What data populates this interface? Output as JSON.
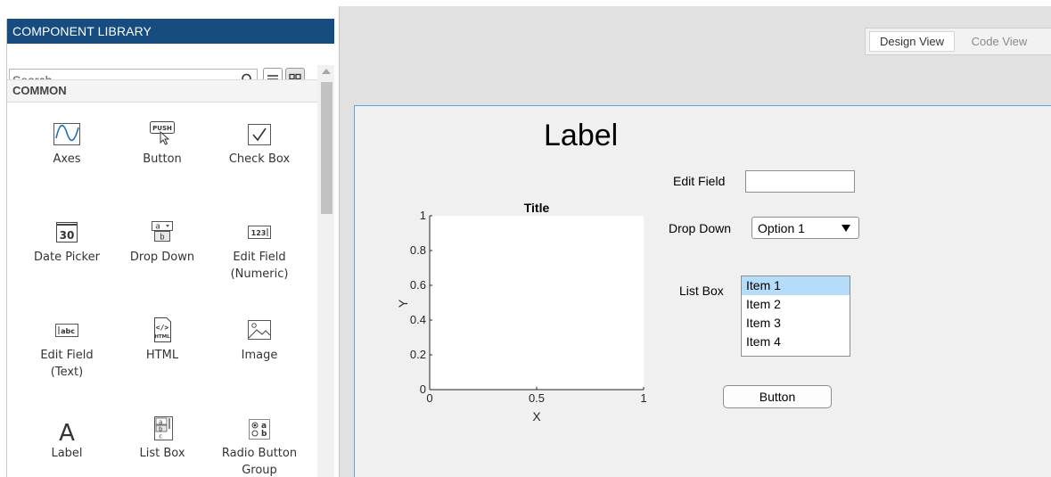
{
  "library": {
    "header": "COMPONENT LIBRARY",
    "search_placeholder": "Search",
    "category": "COMMON",
    "components": [
      {
        "label": "Axes",
        "icon": "axes-icon"
      },
      {
        "label": "Button",
        "icon": "push-button-icon",
        "icon_text": "PUSH"
      },
      {
        "label": "Check Box",
        "icon": "checkbox-icon"
      },
      {
        "label": "Date Picker",
        "icon": "calendar-icon",
        "icon_text": "30"
      },
      {
        "label": "Drop Down",
        "icon": "dropdown-icon",
        "icon_text_a": "a",
        "icon_text_b": "b"
      },
      {
        "label": "Edit Field\n(Numeric)",
        "label_line1": "Edit Field",
        "label_line2": "(Numeric)",
        "icon": "numeric-field-icon",
        "icon_text": "123"
      },
      {
        "label_line1": "Edit Field",
        "label_line2": "(Text)",
        "icon": "text-field-icon",
        "icon_text": "abc"
      },
      {
        "label": "HTML",
        "icon": "html-icon",
        "icon_text_a": "</>",
        "icon_text_b": "HTML"
      },
      {
        "label": "Image",
        "icon": "image-icon"
      },
      {
        "label": "Label",
        "icon": "label-icon",
        "icon_text": "A"
      },
      {
        "label": "List Box",
        "icon": "listbox-icon",
        "icon_text_a": "a",
        "icon_text_b": "b",
        "icon_text_c": "c"
      },
      {
        "label_line1": "Radio Button",
        "label_line2": "Group",
        "icon": "radio-group-icon",
        "icon_text_a": "a",
        "icon_text_b": "b"
      }
    ]
  },
  "toolstrip": {
    "design_view": "Design View",
    "code_view": "Code View",
    "active": "Design View"
  },
  "app": {
    "label": "Label",
    "edit_field_label": "Edit Field",
    "edit_field_value": "",
    "drop_down_label": "Drop Down",
    "drop_down_value": "Option 1",
    "list_box_label": "List Box",
    "list_box_items": [
      "Item 1",
      "Item 2",
      "Item 3",
      "Item 4"
    ],
    "list_box_selected": "Item 1",
    "button_label": "Button"
  },
  "chart_data": {
    "type": "line",
    "title": "Title",
    "xlabel": "X",
    "ylabel": "Y",
    "xlim": [
      0,
      1
    ],
    "ylim": [
      0,
      1
    ],
    "xticks": [
      "0",
      "0.5",
      "1"
    ],
    "yticks": [
      "0",
      "0.2",
      "0.4",
      "0.6",
      "0.8",
      "1"
    ],
    "series": [],
    "grid": false
  },
  "colors": {
    "library_header": "#164c7f",
    "selection": "#b5dcf9",
    "canvas_border": "#5aa5e0"
  }
}
